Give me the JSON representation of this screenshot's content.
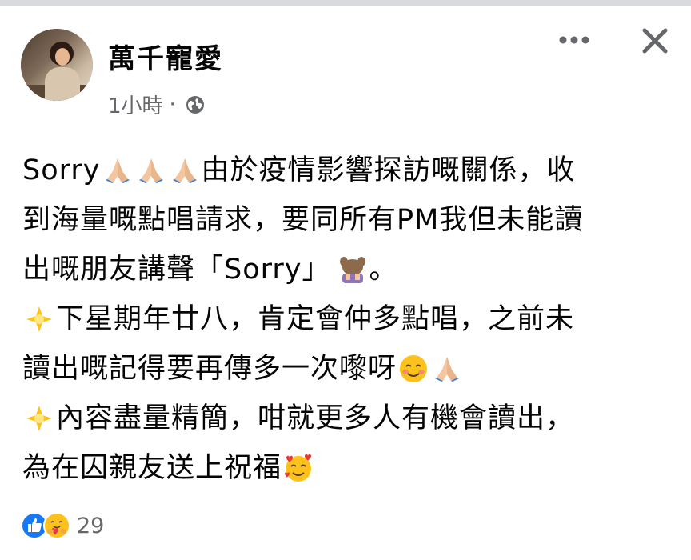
{
  "post": {
    "author": "萬千寵愛",
    "time": "1小時",
    "separator": "·",
    "privacy_icon": "globe-icon",
    "lines": [
      {
        "a": "Sorry ",
        "b": "由於疫情影響探訪嘅關係，收"
      },
      {
        "a": "到海量嘅點唱請求，要同所有PM我但未能讀"
      },
      {
        "a": "出嘅朋友講聲「Sorry」",
        "b": "。"
      },
      {
        "a": "下星期年廿八，肯定會仲多點唱，之前未"
      },
      {
        "a": "讀出嘅記得要再傳多一次嚟呀"
      },
      {
        "a": "內容盡量精簡，咁就更多人有機會讀出，"
      },
      {
        "a": "為在囚親友送上祝福"
      }
    ]
  },
  "header": {
    "more_icon": "more-options-icon",
    "close_icon": "close-icon"
  },
  "reactions": {
    "count": "29",
    "icons": [
      "like-icon",
      "care-icon"
    ]
  },
  "colors": {
    "like_blue": "#1877f2",
    "meta_gray": "#65676b",
    "text": "#050505"
  }
}
